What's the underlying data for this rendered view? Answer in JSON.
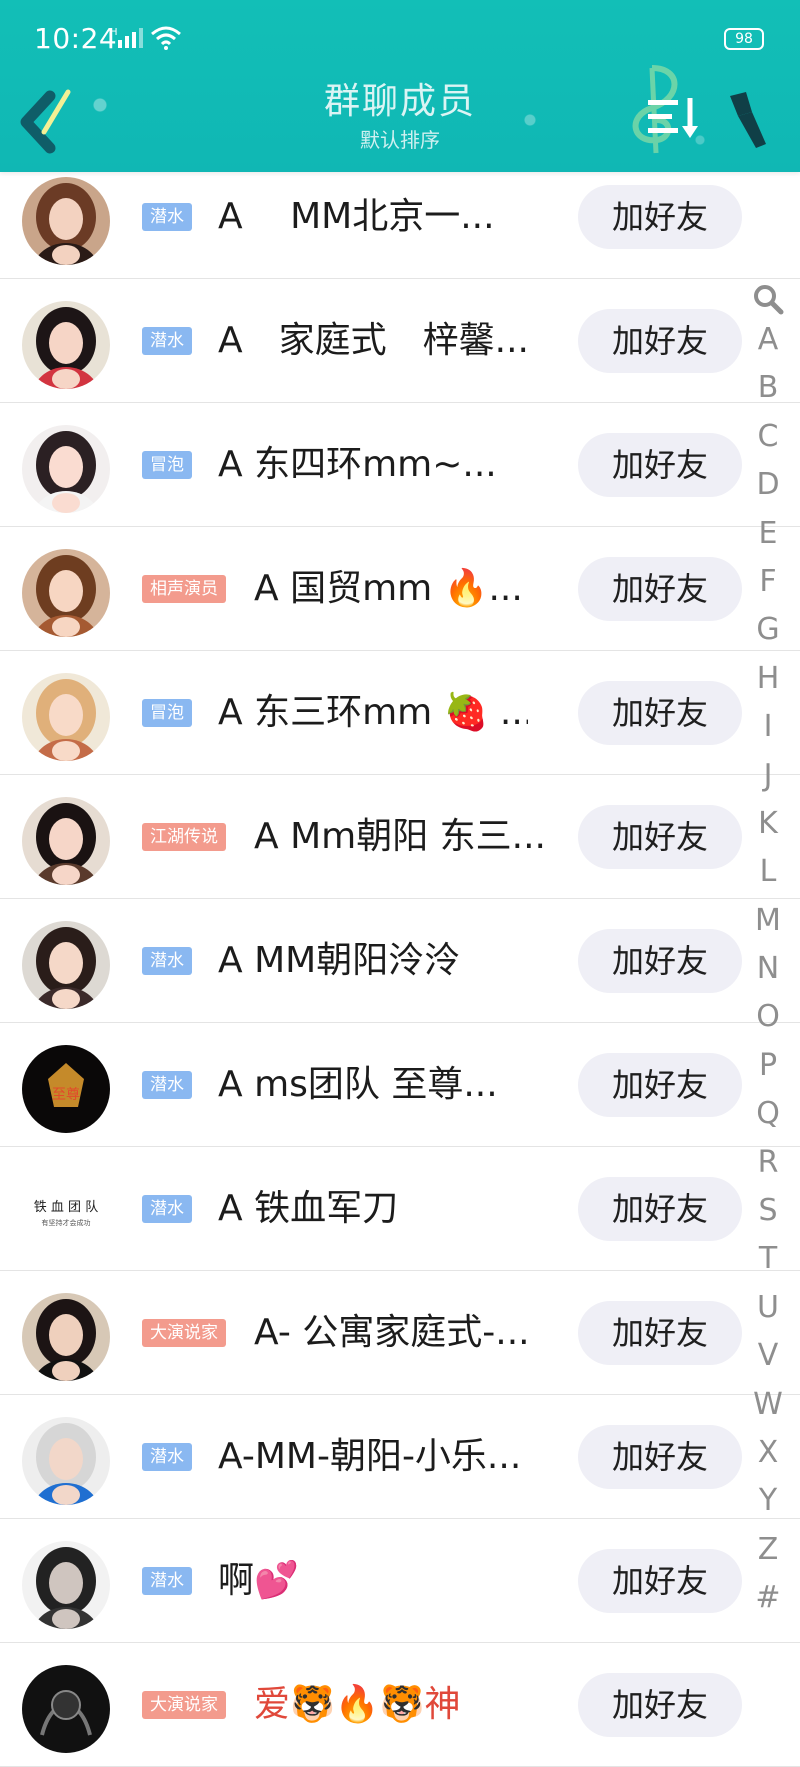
{
  "status_bar": {
    "time": "10:24",
    "battery": "98"
  },
  "header": {
    "title": "群聊成员",
    "subtitle": "默认排序"
  },
  "colors": {
    "header": "#12bfb7",
    "badge_blue": "#8ab8f1",
    "badge_salmon": "#f39b8d",
    "button_bg": "#efeff6"
  },
  "index_letters": [
    "A",
    "B",
    "C",
    "D",
    "E",
    "F",
    "G",
    "H",
    "I",
    "J",
    "K",
    "L",
    "M",
    "N",
    "O",
    "P",
    "Q",
    "R",
    "S",
    "T",
    "U",
    "V",
    "W",
    "X",
    "Y",
    "Z",
    "#"
  ],
  "members": [
    {
      "badge": "潜水",
      "badge_color": "blue",
      "name": "A　 MM北京一...",
      "button": "加好友"
    },
    {
      "badge": "潜水",
      "badge_color": "blue",
      "name": "A　家庭式　梓馨...",
      "button": "加好友"
    },
    {
      "badge": "冒泡",
      "badge_color": "blue",
      "name": "A  东四环mm~...",
      "button": "加好友"
    },
    {
      "badge": "相声演员",
      "badge_color": "salmon",
      "name": "A  国贸mm 🔥...",
      "button": "加好友"
    },
    {
      "badge": "冒泡",
      "badge_color": "blue",
      "name": "A 东三环mm 🍓 ...",
      "button": "加好友"
    },
    {
      "badge": "江湖传说",
      "badge_color": "salmon",
      "name": "A Mm朝阳 东三...",
      "button": "加好友"
    },
    {
      "badge": "潜水",
      "badge_color": "blue",
      "name": "A MM朝阳泠泠",
      "button": "加好友"
    },
    {
      "badge": "潜水",
      "badge_color": "blue",
      "name": "A ms团队  至尊...",
      "button": "加好友"
    },
    {
      "badge": "潜水",
      "badge_color": "blue",
      "name": "A 铁血军刀",
      "button": "加好友"
    },
    {
      "badge": "大演说家",
      "badge_color": "salmon",
      "name": "A- 公寓家庭式-...",
      "button": "加好友"
    },
    {
      "badge": "潜水",
      "badge_color": "blue",
      "name": "A-MM-朝阳-小乐...",
      "button": "加好友"
    },
    {
      "badge": "潜水",
      "badge_color": "blue",
      "name": "啊💕",
      "button": "加好友"
    },
    {
      "badge": "大演说家",
      "badge_color": "salmon",
      "name": "爱🐯🔥🐯神",
      "button": "加好友",
      "name_color": "#e0483a"
    }
  ]
}
